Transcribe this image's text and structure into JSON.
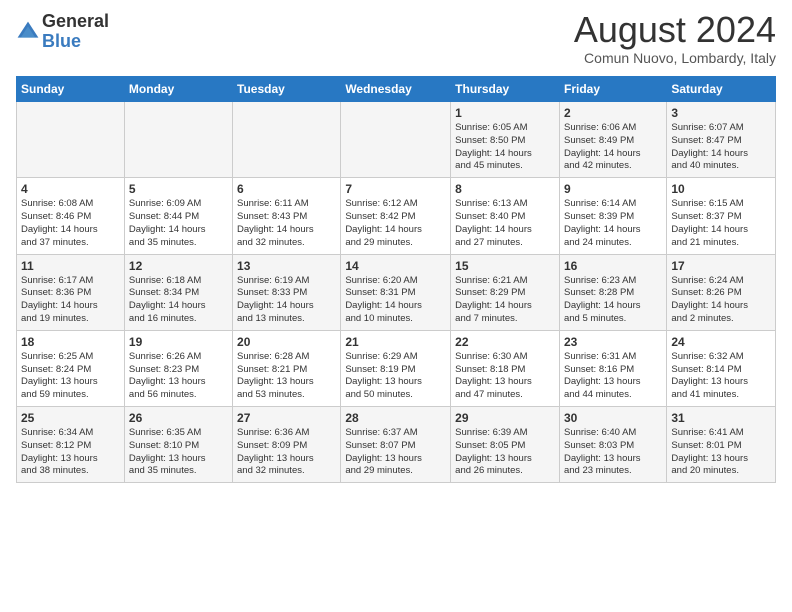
{
  "logo": {
    "general": "General",
    "blue": "Blue"
  },
  "title": "August 2024",
  "subtitle": "Comun Nuovo, Lombardy, Italy",
  "days_header": [
    "Sunday",
    "Monday",
    "Tuesday",
    "Wednesday",
    "Thursday",
    "Friday",
    "Saturday"
  ],
  "weeks": [
    [
      {
        "day": "",
        "info": ""
      },
      {
        "day": "",
        "info": ""
      },
      {
        "day": "",
        "info": ""
      },
      {
        "day": "",
        "info": ""
      },
      {
        "day": "1",
        "info": "Sunrise: 6:05 AM\nSunset: 8:50 PM\nDaylight: 14 hours\nand 45 minutes."
      },
      {
        "day": "2",
        "info": "Sunrise: 6:06 AM\nSunset: 8:49 PM\nDaylight: 14 hours\nand 42 minutes."
      },
      {
        "day": "3",
        "info": "Sunrise: 6:07 AM\nSunset: 8:47 PM\nDaylight: 14 hours\nand 40 minutes."
      }
    ],
    [
      {
        "day": "4",
        "info": "Sunrise: 6:08 AM\nSunset: 8:46 PM\nDaylight: 14 hours\nand 37 minutes."
      },
      {
        "day": "5",
        "info": "Sunrise: 6:09 AM\nSunset: 8:44 PM\nDaylight: 14 hours\nand 35 minutes."
      },
      {
        "day": "6",
        "info": "Sunrise: 6:11 AM\nSunset: 8:43 PM\nDaylight: 14 hours\nand 32 minutes."
      },
      {
        "day": "7",
        "info": "Sunrise: 6:12 AM\nSunset: 8:42 PM\nDaylight: 14 hours\nand 29 minutes."
      },
      {
        "day": "8",
        "info": "Sunrise: 6:13 AM\nSunset: 8:40 PM\nDaylight: 14 hours\nand 27 minutes."
      },
      {
        "day": "9",
        "info": "Sunrise: 6:14 AM\nSunset: 8:39 PM\nDaylight: 14 hours\nand 24 minutes."
      },
      {
        "day": "10",
        "info": "Sunrise: 6:15 AM\nSunset: 8:37 PM\nDaylight: 14 hours\nand 21 minutes."
      }
    ],
    [
      {
        "day": "11",
        "info": "Sunrise: 6:17 AM\nSunset: 8:36 PM\nDaylight: 14 hours\nand 19 minutes."
      },
      {
        "day": "12",
        "info": "Sunrise: 6:18 AM\nSunset: 8:34 PM\nDaylight: 14 hours\nand 16 minutes."
      },
      {
        "day": "13",
        "info": "Sunrise: 6:19 AM\nSunset: 8:33 PM\nDaylight: 14 hours\nand 13 minutes."
      },
      {
        "day": "14",
        "info": "Sunrise: 6:20 AM\nSunset: 8:31 PM\nDaylight: 14 hours\nand 10 minutes."
      },
      {
        "day": "15",
        "info": "Sunrise: 6:21 AM\nSunset: 8:29 PM\nDaylight: 14 hours\nand 7 minutes."
      },
      {
        "day": "16",
        "info": "Sunrise: 6:23 AM\nSunset: 8:28 PM\nDaylight: 14 hours\nand 5 minutes."
      },
      {
        "day": "17",
        "info": "Sunrise: 6:24 AM\nSunset: 8:26 PM\nDaylight: 14 hours\nand 2 minutes."
      }
    ],
    [
      {
        "day": "18",
        "info": "Sunrise: 6:25 AM\nSunset: 8:24 PM\nDaylight: 13 hours\nand 59 minutes."
      },
      {
        "day": "19",
        "info": "Sunrise: 6:26 AM\nSunset: 8:23 PM\nDaylight: 13 hours\nand 56 minutes."
      },
      {
        "day": "20",
        "info": "Sunrise: 6:28 AM\nSunset: 8:21 PM\nDaylight: 13 hours\nand 53 minutes."
      },
      {
        "day": "21",
        "info": "Sunrise: 6:29 AM\nSunset: 8:19 PM\nDaylight: 13 hours\nand 50 minutes."
      },
      {
        "day": "22",
        "info": "Sunrise: 6:30 AM\nSunset: 8:18 PM\nDaylight: 13 hours\nand 47 minutes."
      },
      {
        "day": "23",
        "info": "Sunrise: 6:31 AM\nSunset: 8:16 PM\nDaylight: 13 hours\nand 44 minutes."
      },
      {
        "day": "24",
        "info": "Sunrise: 6:32 AM\nSunset: 8:14 PM\nDaylight: 13 hours\nand 41 minutes."
      }
    ],
    [
      {
        "day": "25",
        "info": "Sunrise: 6:34 AM\nSunset: 8:12 PM\nDaylight: 13 hours\nand 38 minutes."
      },
      {
        "day": "26",
        "info": "Sunrise: 6:35 AM\nSunset: 8:10 PM\nDaylight: 13 hours\nand 35 minutes."
      },
      {
        "day": "27",
        "info": "Sunrise: 6:36 AM\nSunset: 8:09 PM\nDaylight: 13 hours\nand 32 minutes."
      },
      {
        "day": "28",
        "info": "Sunrise: 6:37 AM\nSunset: 8:07 PM\nDaylight: 13 hours\nand 29 minutes."
      },
      {
        "day": "29",
        "info": "Sunrise: 6:39 AM\nSunset: 8:05 PM\nDaylight: 13 hours\nand 26 minutes."
      },
      {
        "day": "30",
        "info": "Sunrise: 6:40 AM\nSunset: 8:03 PM\nDaylight: 13 hours\nand 23 minutes."
      },
      {
        "day": "31",
        "info": "Sunrise: 6:41 AM\nSunset: 8:01 PM\nDaylight: 13 hours\nand 20 minutes."
      }
    ]
  ]
}
